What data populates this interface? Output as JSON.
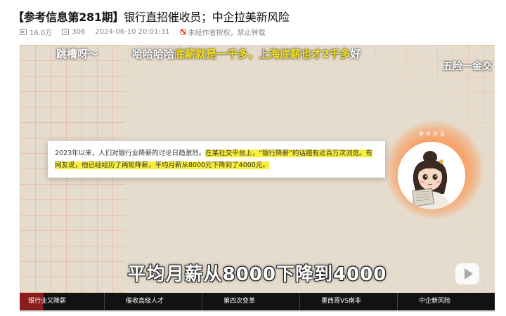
{
  "article": {
    "title_bracket": "【参考信息第281期】",
    "title_rest": "银行直招催收员；中企拉美新风险",
    "views": "16.0万",
    "comments": "306",
    "datetime": "2024-06-10 20:01:31",
    "notice": "未经作者授权，禁止转载"
  },
  "video": {
    "top_left_caption": "跳槽呀～",
    "top_caption_plain": "哈哈哈哈",
    "top_caption_highlight": "底薪就是一千多，上海底薪也才2千多",
    "top_caption_tail": "好",
    "top_right_caption": "五险一金交",
    "card_text_plain": "2023年以来，人们对银行业降薪的讨论日趋激烈。",
    "card_text_highlight": "在某社交平台上，“银行降薪”的话题有近百万次浏览。有网友说，他已经经历了两轮降薪，平均月薪从8000元下降到了4000元。",
    "avatar_label": "参考信息",
    "bottom_caption": "平均月薪从8000下降到4000"
  },
  "chapters": [
    {
      "label": "银行业又降薪"
    },
    {
      "label": "催收高级人才"
    },
    {
      "label": "第四次变革"
    },
    {
      "label": "墨西哥VS南非"
    },
    {
      "label": "中企新风险"
    }
  ],
  "icons": {
    "views": "play-count-icon",
    "comments": "comment-icon",
    "notice": "no-repost-icon",
    "play": "play-icon"
  },
  "colors": {
    "highlight": "#f8ee3a",
    "caption_yellow": "#f7e21a",
    "active_chapter": "#8a1c1c",
    "warning_red": "#e04040"
  }
}
